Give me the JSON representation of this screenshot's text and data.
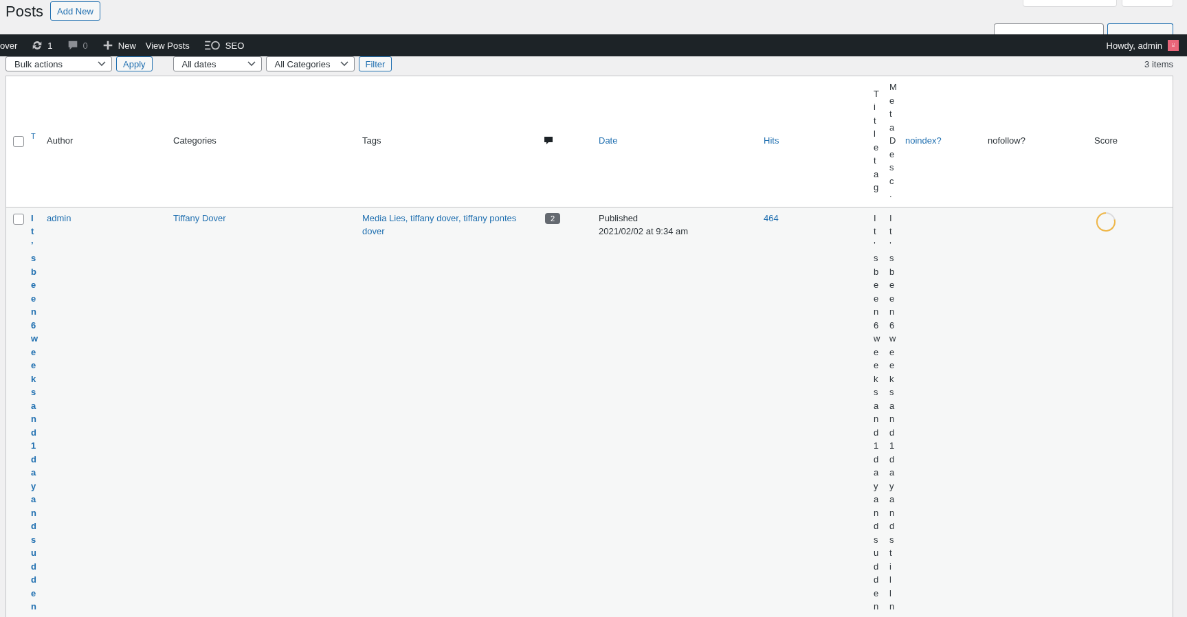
{
  "page": {
    "title": "Posts",
    "add_new": "Add New"
  },
  "admin_bar": {
    "site": "over",
    "updates": "1",
    "comments": "0",
    "new": "New",
    "view": "View Posts",
    "seo": "SEO",
    "greeting": "Howdy, admin"
  },
  "filters": {
    "bulk": "Bulk actions",
    "apply": "Apply",
    "dates": "All dates",
    "categories": "All Categories",
    "filter": "Filter",
    "count": "3 items"
  },
  "table": {
    "select_all": {
      "checked": false
    },
    "columns": [
      {
        "label": "T",
        "kind": "link"
      },
      {
        "label": "Author",
        "kind": "text"
      },
      {
        "label": "Categories",
        "kind": "text"
      },
      {
        "label": "Tags",
        "kind": "text"
      },
      {
        "kind": "comments"
      },
      {
        "label": "Date",
        "kind": "link"
      },
      {
        "label": "Hits",
        "kind": "link"
      },
      {
        "label": "Title tag",
        "kind": "vertical"
      },
      {
        "label": "Meta Desc.",
        "kind": "vertical"
      },
      {
        "label": "noindex?",
        "kind": "link"
      },
      {
        "label": "nofollow?",
        "kind": "text"
      },
      {
        "label": "Score",
        "kind": "text"
      }
    ],
    "rows": [
      {
        "checked": false,
        "title": "It’s been 6 weeks and 1 day and sudden",
        "author": "admin",
        "categories": "Tiffany Dover",
        "tags": "Media Lies, tiffany dover, tiffany pontes dover",
        "comments": "2",
        "status": "Published",
        "date": "2021/02/02 at 9:34 am",
        "hits": "464",
        "title_tag": "It’s been 6 weeks and 1 day and sudden",
        "meta_desc": "It’s been 6 weeks and 1 day and still n"
      }
    ]
  }
}
